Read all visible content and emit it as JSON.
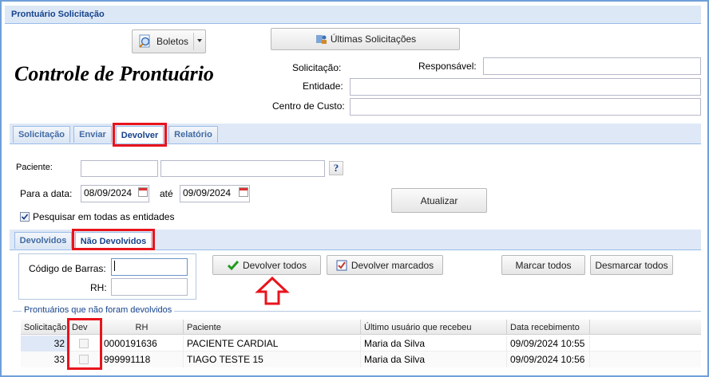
{
  "window": {
    "title": "Prontuário Solicitação"
  },
  "header": {
    "boletos_label": "Boletos",
    "ultimas_label": "Últimas Solicitações",
    "page_title": "Controle de Prontuário",
    "solicitacao_label": "Solicitação:",
    "responsavel_label": "Responsável:",
    "entidade_label": "Entidade:",
    "centro_label": "Centro de Custo:"
  },
  "main_tabs": [
    {
      "label": "Solicitação",
      "active": false
    },
    {
      "label": "Enviar",
      "active": false
    },
    {
      "label": "Devolver",
      "active": true
    },
    {
      "label": "Relatório",
      "active": false
    }
  ],
  "filters": {
    "paciente_label": "Paciente:",
    "help_symbol": "?",
    "para_data_label": "Para a data:",
    "date_from": "08/09/2024",
    "ate_label": "até",
    "date_to": "09/09/2024",
    "atualizar_label": "Atualizar",
    "pesquisar_label": "Pesquisar em todas as entidades",
    "pesquisar_checked": true
  },
  "sub_tabs": [
    {
      "label": "Devolvidos",
      "active": false
    },
    {
      "label": "Não Devolvidos",
      "active": true
    }
  ],
  "devolver": {
    "codigo_label": "Código de Barras:",
    "rh_label": "RH:",
    "devolver_todos": "Devolver todos",
    "devolver_marcados": "Devolver marcados",
    "marcar_todos": "Marcar todos",
    "desmarcar_todos": "Desmarcar todos"
  },
  "grid": {
    "legend": "Prontuários que não foram devolvidos",
    "columns": [
      "Solicitação",
      "Dev",
      "RH",
      "Paciente",
      "Último usuário que recebeu",
      "Data recebimento"
    ],
    "rows": [
      {
        "solicitacao": "32",
        "rh": "0000191636",
        "paciente": "PACIENTE CARDIAL",
        "usuario": "Maria da Silva",
        "data": "09/09/2024 10:55"
      },
      {
        "solicitacao": "33",
        "rh": "999991118",
        "paciente": "TIAGO TESTE 15",
        "usuario": "Maria da Silva",
        "data": "09/09/2024 10:56"
      }
    ]
  },
  "colors": {
    "accent": "#15428b",
    "highlight": "#e8141c",
    "tab_bg": "#dfe8f6"
  }
}
